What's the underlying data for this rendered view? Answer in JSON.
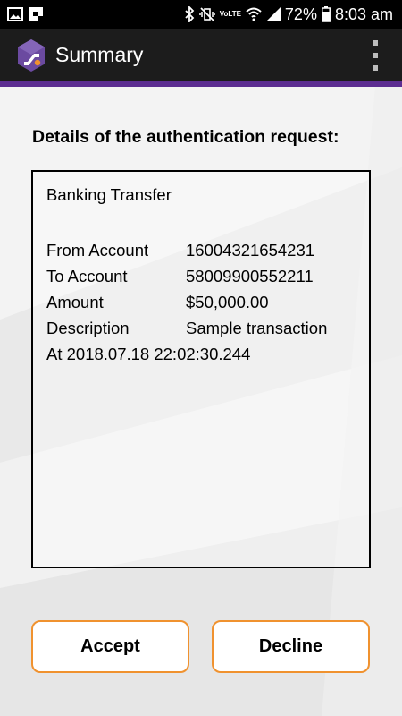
{
  "status_bar": {
    "battery_percent": "72%",
    "time": "8:03 am",
    "network_label": "VoLTE",
    "icons": [
      "image-icon",
      "flipboard-icon",
      "bluetooth-icon",
      "vibrate-icon",
      "volte-icon",
      "wifi-icon",
      "signal-icon",
      "battery-icon"
    ]
  },
  "app_bar": {
    "title": "Summary",
    "logo_icon": "app-hexagon-logo-icon",
    "menu_icon": "overflow-menu-icon"
  },
  "colors": {
    "accent_line": "#5c2d91",
    "button_border": "#f0922f",
    "app_bar": "#1c1c1c"
  },
  "request": {
    "heading": "Details of the authentication request:",
    "title": "Banking Transfer",
    "rows": [
      {
        "label": "From Account",
        "value": "16004321654231"
      },
      {
        "label": "To Account",
        "value": "58009900552211"
      },
      {
        "label": "Amount",
        "value": "$50,000.00"
      },
      {
        "label": "Description",
        "value": "Sample transaction"
      }
    ],
    "timestamp": "At 2018.07.18 22:02:30.244"
  },
  "actions": {
    "accept_label": "Accept",
    "decline_label": "Decline"
  }
}
